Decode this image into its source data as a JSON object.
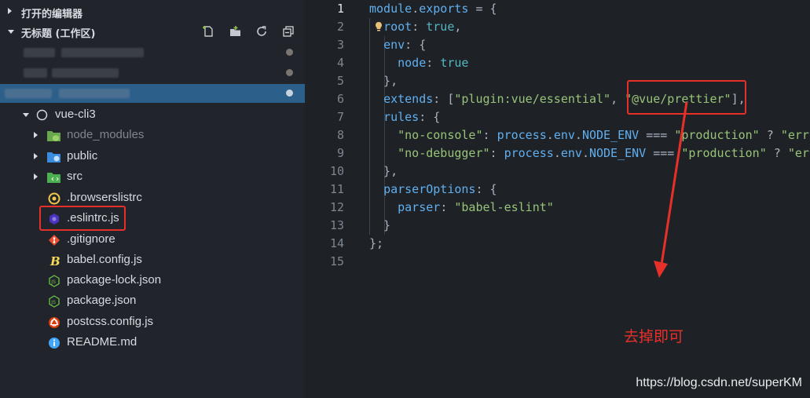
{
  "sidebar": {
    "open_editors_label": "打开的编辑器",
    "workspace_label": "无标题 (工作区)",
    "root_folder": "vue-cli3",
    "items": [
      {
        "name": "node_modules",
        "icon": "node-modules-folder-icon"
      },
      {
        "name": "public",
        "icon": "public-folder-icon"
      },
      {
        "name": "src",
        "icon": "src-folder-icon"
      },
      {
        "name": ".browserslistrc",
        "icon": "browserslist-icon"
      },
      {
        "name": ".eslintrc.js",
        "icon": "eslint-icon"
      },
      {
        "name": ".gitignore",
        "icon": "git-icon"
      },
      {
        "name": "babel.config.js",
        "icon": "babel-icon"
      },
      {
        "name": "package-lock.json",
        "icon": "nodejs-icon"
      },
      {
        "name": "package.json",
        "icon": "nodejs-icon"
      },
      {
        "name": "postcss.config.js",
        "icon": "postcss-icon"
      },
      {
        "name": "README.md",
        "icon": "info-icon"
      }
    ]
  },
  "editor": {
    "line_numbers": [
      "1",
      "2",
      "3",
      "4",
      "5",
      "6",
      "7",
      "8",
      "9",
      "10",
      "11",
      "12",
      "13",
      "14",
      "15"
    ]
  },
  "annotation": {
    "note": "去掉即可",
    "watermark": "https://blog.csdn.net/superKM"
  },
  "colors": {
    "highlight": "#e8302a",
    "selection": "#2c5f8a"
  }
}
